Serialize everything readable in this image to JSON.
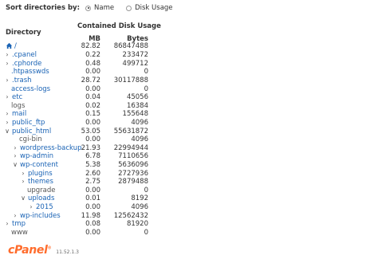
{
  "sort": {
    "label": "Sort directories by:",
    "options": [
      {
        "label": "Name",
        "selected": true
      },
      {
        "label": "Disk Usage",
        "selected": false
      }
    ]
  },
  "headers": {
    "directory": "Directory",
    "contained": "Contained Disk Usage",
    "mb": "MB",
    "bytes": "Bytes"
  },
  "root": {
    "name": "/",
    "mb": "82.82",
    "bytes": "86847488"
  },
  "rows": [
    {
      "name": ".cpanel",
      "mb": "0.22",
      "bytes": "233472",
      "caret": ">",
      "depth": 0,
      "link": true
    },
    {
      "name": ".cphorde",
      "mb": "0.48",
      "bytes": "499712",
      "caret": ">",
      "depth": 0,
      "link": true
    },
    {
      "name": ".htpasswds",
      "mb": "0.00",
      "bytes": "0",
      "caret": "",
      "depth": 0,
      "link": true
    },
    {
      "name": ".trash",
      "mb": "28.72",
      "bytes": "30117888",
      "caret": ">",
      "depth": 0,
      "link": true
    },
    {
      "name": "access-logs",
      "mb": "0.00",
      "bytes": "0",
      "caret": "",
      "depth": 0,
      "link": true
    },
    {
      "name": "etc",
      "mb": "0.04",
      "bytes": "45056",
      "caret": ">",
      "depth": 0,
      "link": true
    },
    {
      "name": "logs",
      "mb": "0.02",
      "bytes": "16384",
      "caret": "",
      "depth": 0,
      "link": false
    },
    {
      "name": "mail",
      "mb": "0.15",
      "bytes": "155648",
      "caret": ">",
      "depth": 0,
      "link": true
    },
    {
      "name": "public_ftp",
      "mb": "0.00",
      "bytes": "4096",
      "caret": ">",
      "depth": 0,
      "link": true
    },
    {
      "name": "public_html",
      "mb": "53.05",
      "bytes": "55631872",
      "caret": "v",
      "depth": 0,
      "link": true
    },
    {
      "name": "cgi-bin",
      "mb": "0.00",
      "bytes": "4096",
      "caret": "",
      "depth": 1,
      "link": false
    },
    {
      "name": "wordpress-backup",
      "mb": "21.93",
      "bytes": "22994944",
      "caret": ">",
      "depth": 1,
      "link": true
    },
    {
      "name": "wp-admin",
      "mb": "6.78",
      "bytes": "7110656",
      "caret": ">",
      "depth": 1,
      "link": true
    },
    {
      "name": "wp-content",
      "mb": "5.38",
      "bytes": "5636096",
      "caret": "v",
      "depth": 1,
      "link": true
    },
    {
      "name": "plugins",
      "mb": "2.60",
      "bytes": "2727936",
      "caret": ">",
      "depth": 2,
      "link": true
    },
    {
      "name": "themes",
      "mb": "2.75",
      "bytes": "2879488",
      "caret": ">",
      "depth": 2,
      "link": true
    },
    {
      "name": "upgrade",
      "mb": "0.00",
      "bytes": "0",
      "caret": "",
      "depth": 2,
      "link": false
    },
    {
      "name": "uploads",
      "mb": "0.01",
      "bytes": "8192",
      "caret": "v",
      "depth": 2,
      "link": true
    },
    {
      "name": "2015",
      "mb": "0.00",
      "bytes": "4096",
      "caret": ">",
      "depth": 3,
      "link": true
    },
    {
      "name": "wp-includes",
      "mb": "11.98",
      "bytes": "12562432",
      "caret": ">",
      "depth": 1,
      "link": true
    },
    {
      "name": "tmp",
      "mb": "0.08",
      "bytes": "81920",
      "caret": ">",
      "depth": 0,
      "link": true
    },
    {
      "name": "www",
      "mb": "0.00",
      "bytes": "0",
      "caret": "",
      "depth": 0,
      "link": false
    }
  ],
  "footer": {
    "logo": "cPanel",
    "version": "11.52.1.3"
  },
  "colors": {
    "link": "#1a63b5",
    "brand": "#ff6c2c"
  }
}
